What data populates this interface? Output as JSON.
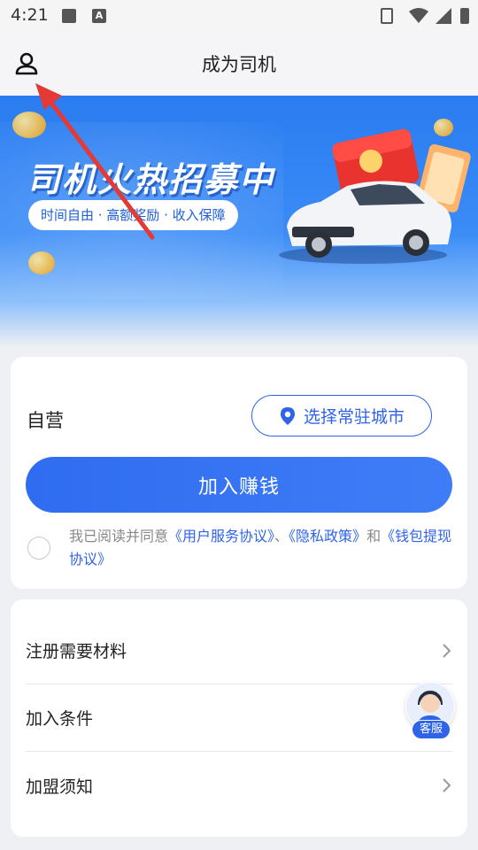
{
  "status_bar": {
    "time": "4:21",
    "icons": [
      "image-icon",
      "text-a-icon",
      "vibrate-icon",
      "wifi-icon",
      "cellular-icon",
      "battery-icon"
    ]
  },
  "header": {
    "title": "成为司机",
    "left_icon": "user-icon"
  },
  "banner": {
    "title": "司机火热招募中",
    "tagline": "时间自由 · 高额奖励 · 收入保障",
    "colors": {
      "primary": "#2a7cf0",
      "accent": "#ffffff"
    }
  },
  "join_card": {
    "mode_label": "自营",
    "city_button": "选择常驻城市",
    "join_button": "加入赚钱",
    "agreement": {
      "prefix": "我已阅读并同意",
      "link1": "《用户服务协议》",
      "sep1": "、",
      "link2": "《隐私政策》",
      "sep2": "和",
      "link3": "《钱包提现协议》",
      "checked": false
    }
  },
  "info_card": {
    "rows": [
      {
        "label": "注册需要材料"
      },
      {
        "label": "加入条件"
      },
      {
        "label": "加盟须知"
      }
    ]
  },
  "customer_service": {
    "badge": "客服"
  },
  "theme": {
    "brand_blue": "#2f63e8",
    "annotation_red": "#e53935"
  }
}
